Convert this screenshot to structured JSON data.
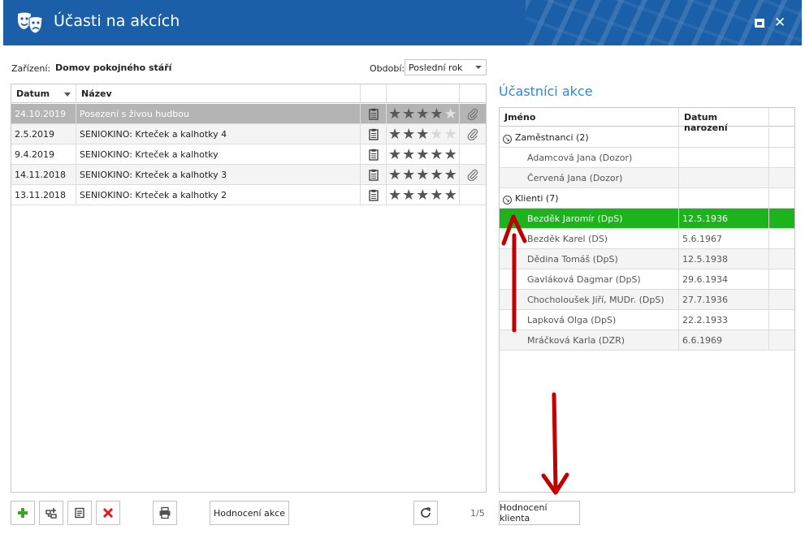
{
  "window": {
    "title": "Účasti na akcích"
  },
  "filters": {
    "facility_label": "Zařízení:",
    "facility_value": "Domov pokojného stáří",
    "period_label": "Období:",
    "period_value": "Poslední rok"
  },
  "events": {
    "columns": {
      "date": "Datum",
      "name": "Název"
    },
    "rows": [
      {
        "date": "24.10.2019",
        "name": "Posezení s živou hudbou",
        "rating": 4,
        "attachment": true
      },
      {
        "date": "2.5.2019",
        "name": "SENIOKINO: Krteček a kalhotky 4",
        "rating": 3,
        "attachment": true
      },
      {
        "date": "9.4.2019",
        "name": "SENIOKINO: Krteček a kalhotky",
        "rating": 5,
        "attachment": false
      },
      {
        "date": "14.11.2018",
        "name": "SENIOKINO: Krteček a kalhotky 3",
        "rating": 5,
        "attachment": true
      },
      {
        "date": "13.11.2018",
        "name": "SENIOKINO: Krteček a kalhotky 2",
        "rating": 5,
        "attachment": false
      }
    ]
  },
  "participants": {
    "title": "Účastníci akce",
    "columns": {
      "name": "Jméno",
      "birth": "Datum narození"
    },
    "groups": [
      {
        "label": "Zaměstnanci (2)",
        "people": [
          {
            "name": "Adamcová Jana (Dozor)",
            "birth": ""
          },
          {
            "name": "Červená Jana (Dozor)",
            "birth": ""
          }
        ]
      },
      {
        "label": "Klienti (7)",
        "people": [
          {
            "name": "Bezděk Jaromír (DpS)",
            "birth": "12.5.1936"
          },
          {
            "name": "Bezděk Karel (DS)",
            "birth": "5.6.1967"
          },
          {
            "name": "Dědina Tomáš (DpS)",
            "birth": "12.5.1938"
          },
          {
            "name": "Gavláková Dagmar (DpS)",
            "birth": "29.6.1934"
          },
          {
            "name": "Chocholoušek Jiří, MUDr. (DpS)",
            "birth": "27.7.1936"
          },
          {
            "name": "Lapková Olga (DpS)",
            "birth": "22.2.1933"
          },
          {
            "name": "Mráčková Karla (DZR)",
            "birth": "6.6.1969"
          }
        ]
      }
    ]
  },
  "toolbar": {
    "rate_event_label": "Hodnocení akce",
    "pager": "1/5",
    "rate_client_label": "Hodnocení klienta"
  },
  "colors": {
    "titlebar": "#1b5fa8",
    "selected": "#1cb31c",
    "accent": "#2a8ad6",
    "annotation": "#c00000"
  }
}
